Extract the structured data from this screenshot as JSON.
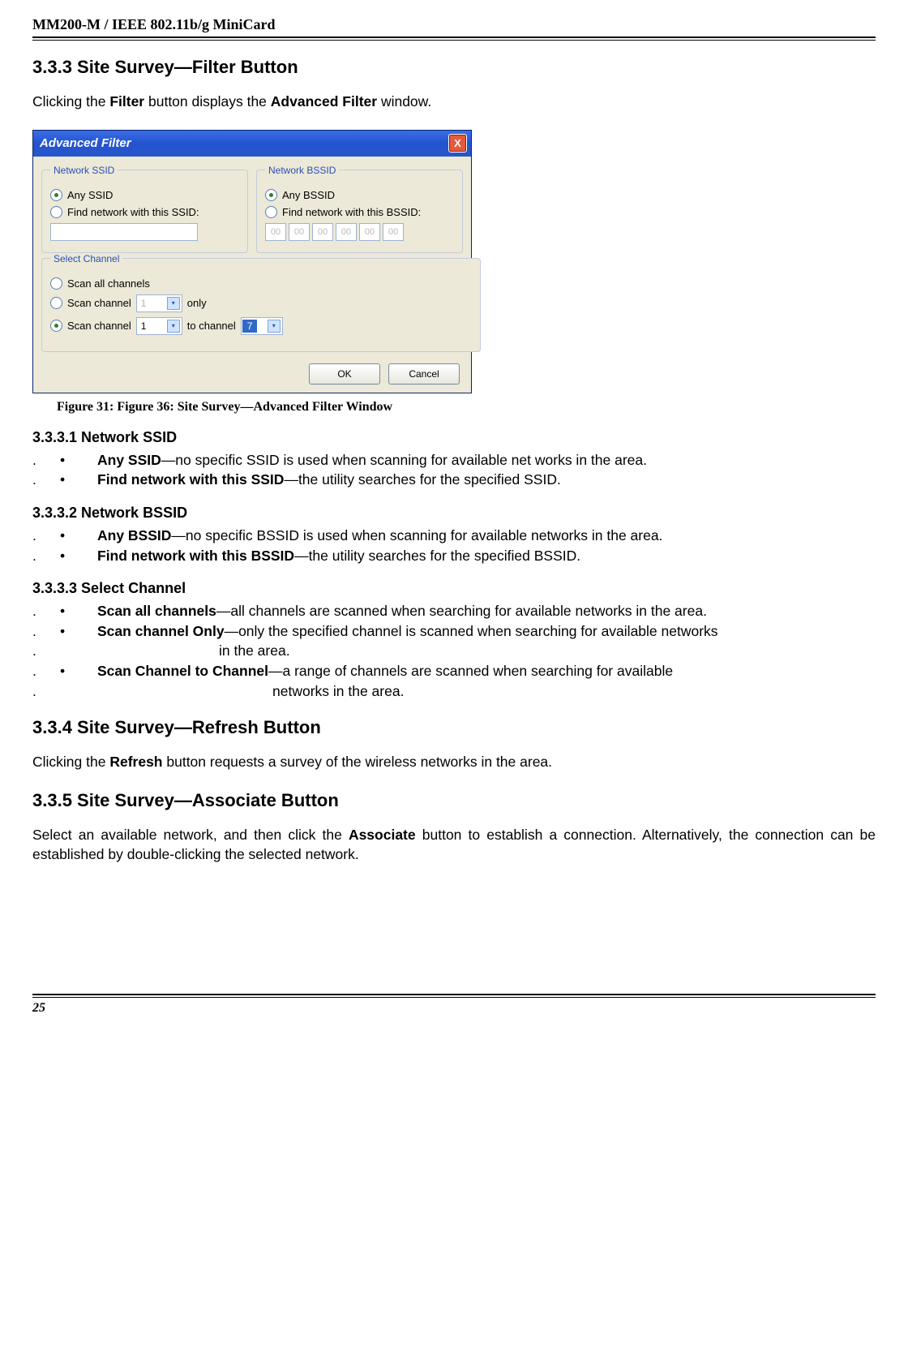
{
  "header": {
    "title": "MM200-M / IEEE 802.11b/g MiniCard"
  },
  "s333": {
    "heading": "3.3.3 Site Survey—Filter Button",
    "intro_pre": "Clicking the ",
    "intro_b1": "Filter",
    "intro_mid": " button displays the ",
    "intro_b2": "Advanced Filter",
    "intro_post": " window."
  },
  "win": {
    "title": "Advanced Filter",
    "close": "X",
    "ssid": {
      "legend": "Network SSID",
      "any": "Any SSID",
      "find": "Find network with this SSID:"
    },
    "bssid": {
      "legend": "Network BSSID",
      "any": "Any BSSID",
      "find": "Find network with this BSSID:",
      "hex": "00"
    },
    "chan": {
      "legend": "Select Channel",
      "all": "Scan all channels",
      "one_pre": "Scan channel",
      "one_post": "only",
      "range_pre": "Scan channel",
      "range_mid": "to channel",
      "sel1": "1",
      "sel2": "1",
      "sel3": "7"
    },
    "ok": "OK",
    "cancel": "Cancel"
  },
  "caption": "Figure 31: Figure 36: Site Survey—Advanced Filter Window",
  "s3331": {
    "heading": "3.3.3.1 Network SSID",
    "b1_label": "Any SSID",
    "b1_text": "—no specific SSID is used when scanning for available net works in the area.",
    "b2_label": "Find network with this SSID",
    "b2_text": "—the utility searches for the specified SSID."
  },
  "s3332": {
    "heading": "3.3.3.2 Network BSSID",
    "b1_label": "Any BSSID",
    "b1_text": "—no specific BSSID is used when scanning for available networks in the area.",
    "b2_label": "Find network with this BSSID",
    "b2_text": "—the utility searches for the specified BSSID."
  },
  "s3333": {
    "heading": "3.3.3.3 Select Channel",
    "b1_label": "Scan all channels",
    "b1_text": "—all channels are scanned when searching for available networks in the area.",
    "b2_label": "Scan channel Only",
    "b2_text": "—only the specified channel is scanned when searching for available networks",
    "b2_cont": "in the area.",
    "b3_label": "Scan Channel to Channel",
    "b3_text": "—a range of channels are scanned when searching for available",
    "b3_cont": "networks in the area."
  },
  "s334": {
    "heading": "3.3.4 Site Survey—Refresh Button",
    "text_pre": "Clicking the ",
    "text_b": "Refresh",
    "text_post": " button requests a survey of the wireless networks in the area."
  },
  "s335": {
    "heading": "3.3.5 Site Survey—Associate Button",
    "text_pre": "Select an available network, and then click the ",
    "text_b": "Associate",
    "text_post": " button to establish a connection. Alternatively, the connection can be established by double-clicking the selected network."
  },
  "footer": {
    "page": "25"
  }
}
